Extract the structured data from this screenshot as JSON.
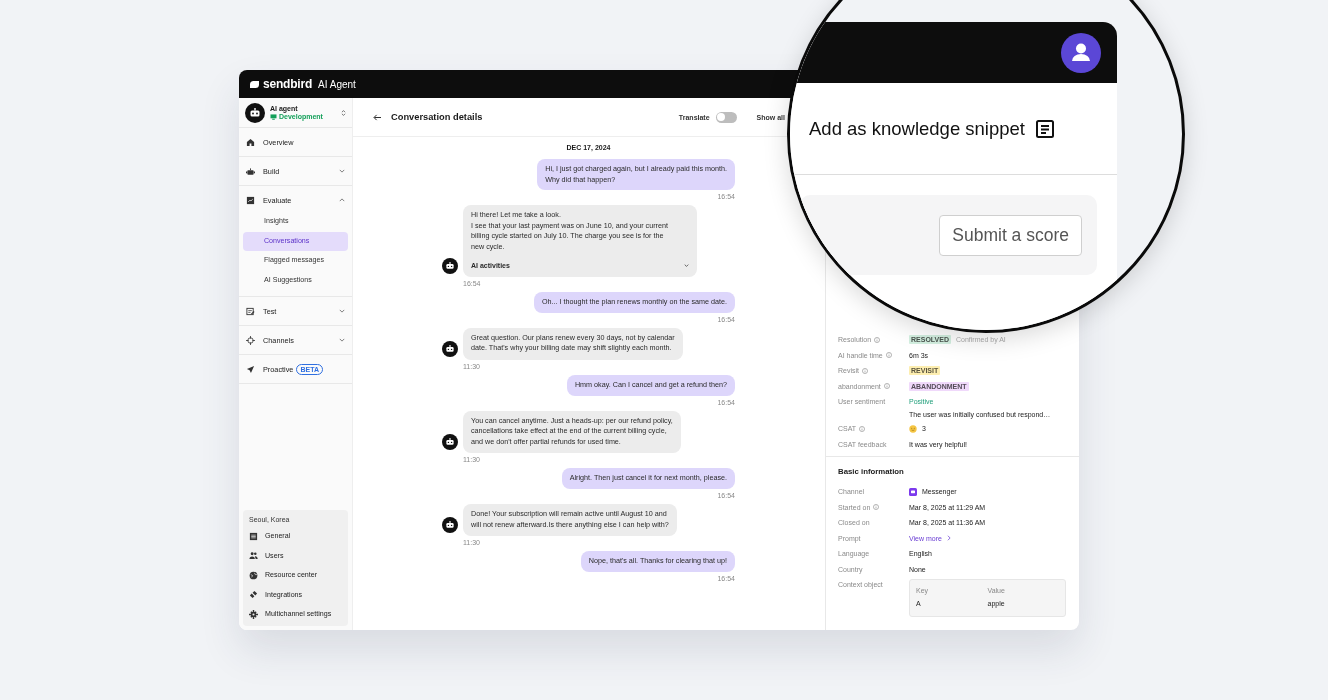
{
  "app": {
    "logo": "sendbird",
    "product": "AI Agent"
  },
  "agent": {
    "name": "AI agent",
    "environment": "Development"
  },
  "nav": [
    {
      "label": "Overview"
    },
    {
      "label": "Build",
      "expanded": false
    },
    {
      "label": "Evaluate",
      "expanded": true,
      "children": [
        {
          "label": "Insights",
          "selected": false
        },
        {
          "label": "Conversations",
          "selected": true
        },
        {
          "label": "Flagged messages",
          "selected": false
        },
        {
          "label": "AI Suggestions",
          "selected": false
        }
      ]
    },
    {
      "label": "Test",
      "expanded": false
    },
    {
      "label": "Channels",
      "expanded": false
    },
    {
      "label": "Proactive",
      "badge": "BETA"
    }
  ],
  "footer": {
    "region": "Seoul, Korea",
    "items": [
      "General",
      "Users",
      "Resource center",
      "Integrations",
      "Multichannel settings"
    ]
  },
  "chat": {
    "title": "Conversation details",
    "translate": {
      "label": "Translate",
      "on": false
    },
    "show_all": "Show all",
    "date": "DEC 17, 2024",
    "messages": [
      {
        "kind": "user",
        "text": "Hi, I just got charged again, but I already paid this month.\nWhy did that happen?",
        "time": "16:54"
      },
      {
        "kind": "bot",
        "text": "Hi there! Let me take a look.\nI see that your last payment was on June 10, and your current\nbilling cycle started on July 10. The charge you see is for the\nnew cycle.",
        "activities": "AI activities",
        "time": "16:54"
      },
      {
        "kind": "user",
        "text": "Oh... I thought the plan renews monthly on the same date.",
        "time": "16:54"
      },
      {
        "kind": "bot",
        "text": "Great question. Our plans renew every 30 days, not by calendar\ndate. That's why your billing date may shift slightly each month.",
        "time": "11:30"
      },
      {
        "kind": "user",
        "text": "Hmm okay. Can I cancel and get a refund then?",
        "time": "16:54"
      },
      {
        "kind": "bot",
        "text": "You can cancel anytime. Just a heads-up: per our refund policy,\ncancellations take effect at the end of the current billing cycle,\nand we don't offer partial refunds for used time.",
        "time": "11:30"
      },
      {
        "kind": "user",
        "text": "Alright. Then just cancel it for next month, please.",
        "time": "16:54"
      },
      {
        "kind": "bot",
        "text": "Done! Your subscription will remain active until August 10 and\nwill not renew afterward.Is there anything else I can help with?",
        "time": "11:30"
      },
      {
        "kind": "user",
        "text": "Nope, that's all. Thanks for clearing that up!",
        "time": "16:54"
      }
    ]
  },
  "evaluation": [
    {
      "label": "Resolution",
      "info": true,
      "kind": "tag",
      "value": "RESOLVED",
      "color": "#d3efe0",
      "note": "Confirmed by AI"
    },
    {
      "label": "AI handle time",
      "info": true,
      "kind": "text",
      "value": "6m 3s"
    },
    {
      "label": "Revisit",
      "info": true,
      "kind": "tag",
      "value": "REVISIT",
      "color": "#fdeeb0"
    },
    {
      "label": "abandonment",
      "info": true,
      "kind": "tag",
      "value": "ABANDONMENT",
      "color": "#f0d9fb"
    },
    {
      "label": "User sentiment",
      "info": false,
      "kind": "sentiment",
      "value": "Positive",
      "note": "The user was initially confused but respond…"
    },
    {
      "label": "CSAT",
      "info": true,
      "kind": "rating",
      "value": "3"
    },
    {
      "label": "CSAT feedback",
      "info": false,
      "kind": "text",
      "value": "It was very helpful!"
    }
  ],
  "basic_info": {
    "title": "Basic information",
    "rows": [
      {
        "label": "Channel",
        "info": false,
        "kind": "channel",
        "value": "Messenger"
      },
      {
        "label": "Started on",
        "info": true,
        "kind": "text",
        "value": "Mar 8, 2025 at 11:29 AM"
      },
      {
        "label": "Closed on",
        "info": false,
        "kind": "text",
        "value": "Mar 8, 2025 at 11:36 AM"
      },
      {
        "label": "Prompt",
        "info": false,
        "kind": "link",
        "value": "View more"
      },
      {
        "label": "Language",
        "info": false,
        "kind": "text",
        "value": "English"
      },
      {
        "label": "Country",
        "info": false,
        "kind": "text",
        "value": "None"
      },
      {
        "label": "Context object",
        "info": false,
        "kind": "table",
        "columns": [
          "Key",
          "Value"
        ],
        "rows": [
          [
            "A",
            "apple"
          ]
        ]
      }
    ]
  },
  "magnifier": {
    "snippet_action": "Add as knowledge snippet",
    "score_button": "Submit a score"
  }
}
